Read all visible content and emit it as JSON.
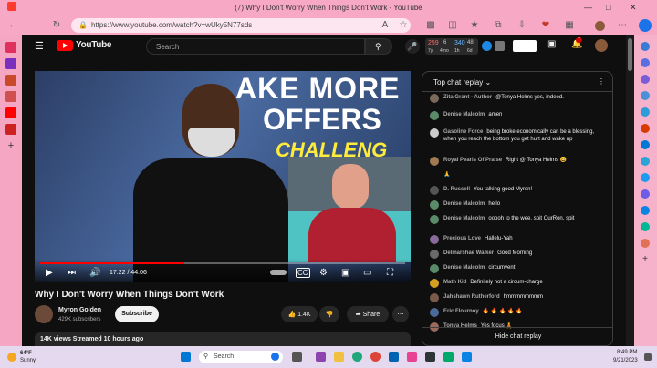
{
  "browser": {
    "tab_title": "(7) Why I Don't Worry When Things Don't Work - YouTube",
    "url": "https://www.youtube.com/watch?v=wUky5N77sds"
  },
  "youtube": {
    "logo_text": "YouTube",
    "search_placeholder": "Search",
    "notification_count": "7",
    "ext_stats": {
      "a": "259",
      "b": "6",
      "c": "340",
      "d": "48",
      "e": "7y",
      "f": "4mo",
      "g": "1h",
      "h": "6d"
    }
  },
  "video": {
    "current_time": "17:22",
    "duration": "44:06",
    "progress": 0.394,
    "overlay_text_1": "AKE MORE",
    "overlay_text_2": "OFFERS",
    "overlay_text_3": "CHALLENG"
  },
  "info": {
    "title": "Why I Don't Worry When Things Don't Work",
    "channel": "Myron Golden",
    "subscribers": "429K subscribers",
    "subscribe_label": "Subscribe",
    "likes": "1.4K",
    "share_label": "Share",
    "views_line": "14K views  Streamed 10 hours ago"
  },
  "chat": {
    "header": "Top chat replay",
    "hide_label": "Hide chat replay",
    "messages": [
      {
        "author": "Zita Grant - Author",
        "text": "@Tonya Helms yes, indeed.",
        "color": "#7a6a5a"
      },
      {
        "author": "Denise Malcolm",
        "text": "amen",
        "color": "#5a8a6a"
      },
      {
        "author": "Gasoline Force",
        "text": "being broke economically can be a blessing, when you reach the bottom you get hurt and wake up",
        "color": "#cccccc"
      },
      {
        "author": "Royal Pearls Of Praise",
        "text": "Right @ Tonya Helms 😄",
        "color": "#a07a50"
      },
      {
        "author": "",
        "text": "🙏",
        "color": ""
      },
      {
        "author": "D. Russell",
        "text": "You talking good Myron!",
        "color": "#555555"
      },
      {
        "author": "Denise Malcolm",
        "text": "hello",
        "color": "#5a8a6a"
      },
      {
        "author": "Denise Malcolm",
        "text": "ooooh to the wee, spit OurRon, spit",
        "color": "#5a8a6a"
      },
      {
        "author": "Precious Love",
        "text": "Hallelu-Yah",
        "color": "#8a6a9a"
      },
      {
        "author": "Delmarshae Walker",
        "text": "Good Morning",
        "color": "#6a6a6a"
      },
      {
        "author": "Denise Malcolm",
        "text": "circumvent",
        "color": "#5a8a6a"
      },
      {
        "author": "Math Kid",
        "text": "Definitely not a circum-charge",
        "color": "#d4a020"
      },
      {
        "author": "Jahshawn Rutherford",
        "text": "hmmmmmmmm",
        "color": "#7a5a4a"
      },
      {
        "author": "Eric Flournoy",
        "text": "🔥 🔥 🔥 🔥 🔥",
        "color": "#4a6a9a"
      },
      {
        "author": "Tonya Helms",
        "text": "Yes focus 🧘",
        "color": "#9a6a5a"
      }
    ]
  },
  "taskbar": {
    "weather_temp": "64°F",
    "weather_desc": "Sunny",
    "search_label": "Search",
    "time": "8:49 PM",
    "date": "9/21/2023"
  }
}
